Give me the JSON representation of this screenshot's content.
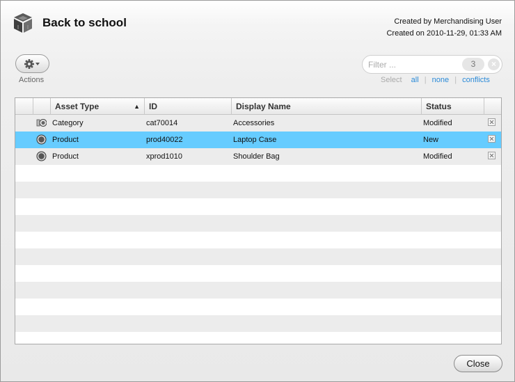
{
  "header": {
    "title": "Back to school",
    "created_by": "Created by Merchandising User",
    "created_on": "Created on 2010-11-29, 01:33 AM",
    "icon": "boxes-icon"
  },
  "toolbar": {
    "actions_label": "Actions",
    "actions_icon": "gear-icon"
  },
  "filter": {
    "placeholder": "Filter ...",
    "value": "",
    "count": "3"
  },
  "select": {
    "label": "Select",
    "all": "all",
    "none": "none",
    "conflicts": "conflicts"
  },
  "grid": {
    "columns": [
      "Asset Type",
      "ID",
      "Display Name",
      "Status"
    ],
    "sort_column": "Asset Type",
    "sort_direction": "ascending",
    "rows": [
      {
        "icon": "category-icon",
        "asset_type": "Category",
        "id": "cat70014",
        "display_name": "Accessories",
        "status": "Modified",
        "selected": false
      },
      {
        "icon": "product-icon",
        "asset_type": "Product",
        "id": "prod40022",
        "display_name": "Laptop Case",
        "status": "New",
        "selected": true
      },
      {
        "icon": "product-icon",
        "asset_type": "Product",
        "id": "xprod1010",
        "display_name": "Shoulder Bag",
        "status": "Modified",
        "selected": false
      }
    ]
  },
  "footer": {
    "close_label": "Close"
  },
  "colors": {
    "selected_row": "#66ccff",
    "link": "#2a8ad8"
  }
}
